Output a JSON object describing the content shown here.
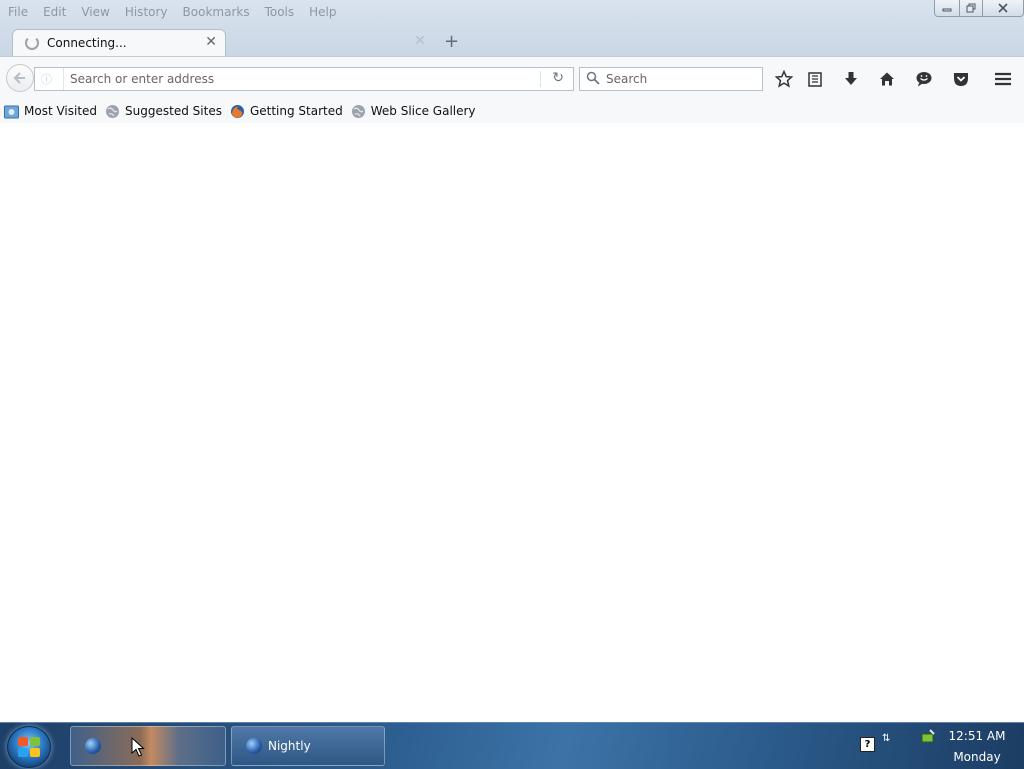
{
  "menubar": {
    "items": [
      {
        "label": "File"
      },
      {
        "label": "Edit"
      },
      {
        "label": "View"
      },
      {
        "label": "History"
      },
      {
        "label": "Bookmarks"
      },
      {
        "label": "Tools"
      },
      {
        "label": "Help"
      }
    ]
  },
  "tabs": [
    {
      "title": "Connecting...",
      "icon": "loading-throbber-icon",
      "close_glyph": "✕"
    }
  ],
  "tabbar": {
    "ghost_close_glyph": "✕",
    "new_tab_glyph": "+"
  },
  "navbar": {
    "url_placeholder": "Search or enter address",
    "url_value": "",
    "search_placeholder": "Search",
    "reload_glyph": "↻"
  },
  "bookmarks": [
    {
      "label": "Most Visited",
      "icon": "most-visited-folder-icon"
    },
    {
      "label": "Suggested Sites",
      "icon": "globe-icon"
    },
    {
      "label": "Getting Started",
      "icon": "firefox-icon"
    },
    {
      "label": "Web Slice Gallery",
      "icon": "globe-icon"
    }
  ],
  "taskbar": {
    "windows": [
      {
        "label": "",
        "icon": "firefox-nightly-icon"
      },
      {
        "label": "Nightly",
        "icon": "firefox-nightly-icon"
      }
    ],
    "tray": {
      "help_glyph": "?",
      "arrows_glyph": "⇅"
    },
    "clock": {
      "time": "12:51 AM",
      "day": "Monday"
    }
  },
  "colors": {
    "titlebar": "#d4dfea",
    "toolbar": "#f7f8fa",
    "taskbar": "#2a5a8c",
    "accent": "#2a79c4"
  }
}
